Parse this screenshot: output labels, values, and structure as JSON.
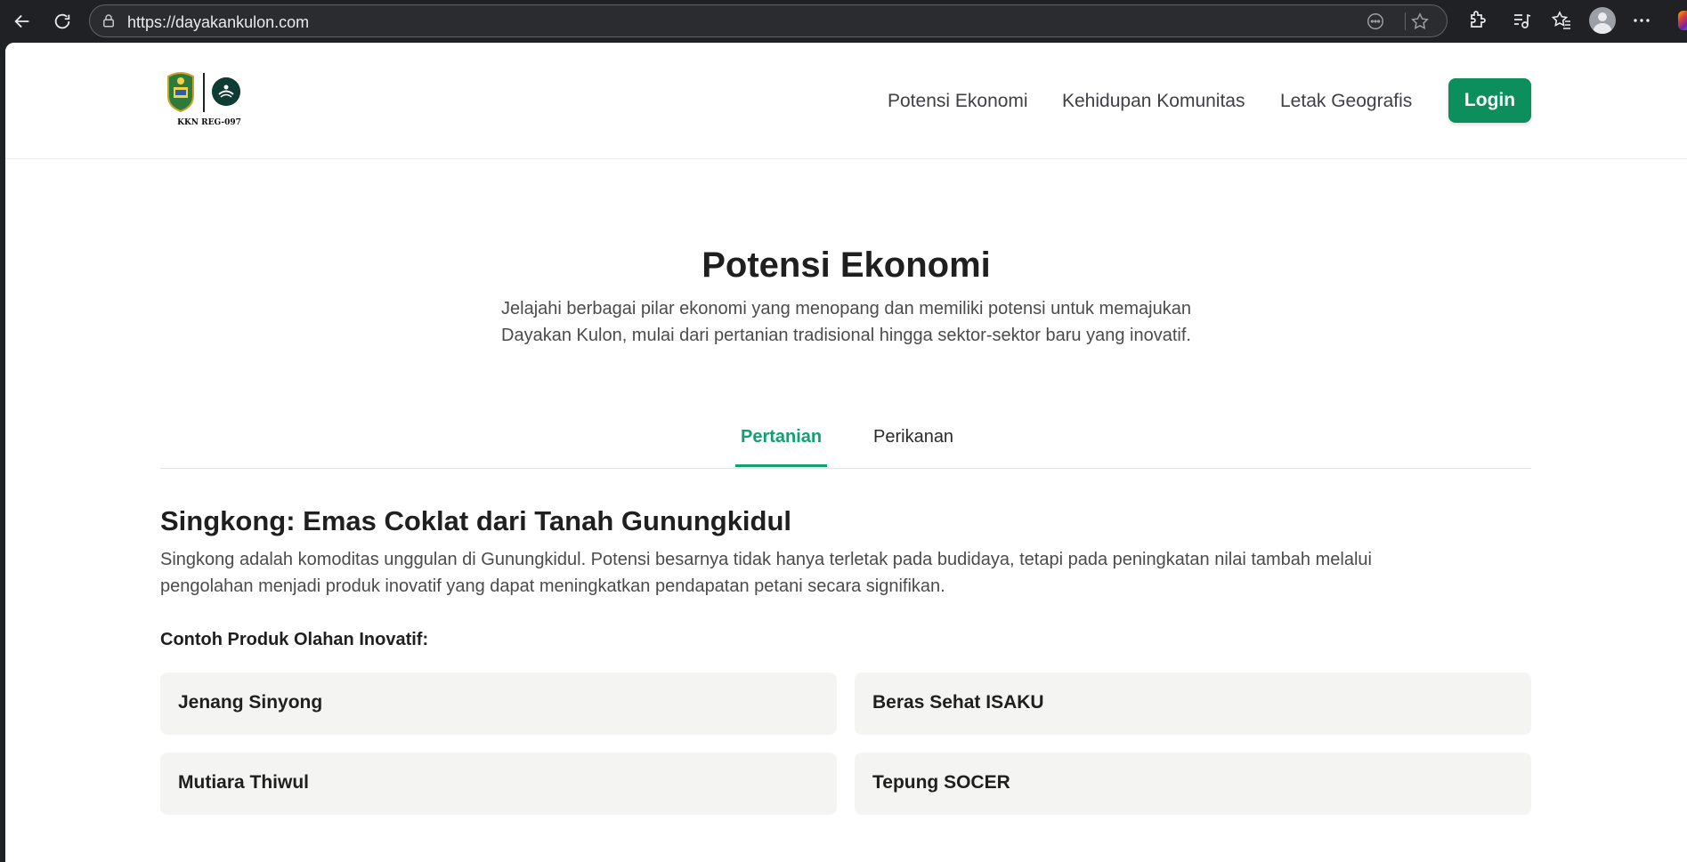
{
  "browser": {
    "url": "https://dayakankulon.com"
  },
  "header": {
    "logo_caption": "KKN REG-097",
    "nav": [
      "Potensi Ekonomi",
      "Kehidupan Komunitas",
      "Letak Geografis"
    ],
    "login_label": "Login"
  },
  "hero": {
    "title": "Potensi Ekonomi",
    "description_line1": "Jelajahi berbagai pilar ekonomi yang menopang dan memiliki potensi untuk memajukan",
    "description_line2": "Dayakan Kulon, mulai dari pertanian tradisional hingga sektor-sektor baru yang inovatif."
  },
  "tabs": {
    "items": [
      "Pertanian",
      "Perikanan"
    ],
    "active": "Pertanian"
  },
  "content": {
    "title": "Singkong: Emas Coklat dari Tanah Gunungkidul",
    "description_line1": "Singkong adalah komoditas unggulan di Gunungkidul. Potensi besarnya tidak hanya terletak pada budidaya, tetapi pada peningkatan nilai tambah melalui",
    "description_line2": "pengolahan menjadi produk inovatif yang dapat meningkatkan pendapatan petani secara signifikan.",
    "products_label": "Contoh Produk Olahan Inovatif:",
    "products": [
      "Jenang Sinyong",
      "Beras Sehat ISAKU",
      "Mutiara Thiwul",
      "Tepung SOCER"
    ]
  },
  "colors": {
    "accent": "#0c8f5d",
    "tab_active": "#12a070",
    "card_bg": "#f4f4f2",
    "chrome_bg": "#202124"
  }
}
